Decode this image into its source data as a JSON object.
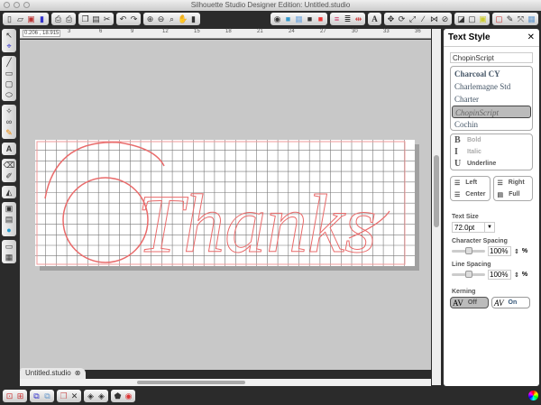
{
  "window": {
    "title": "Silhouette Studio Designer Edition: Untitled.studio"
  },
  "toolbar": {
    "icons": [
      "new",
      "open",
      "save",
      "save-to-sd",
      "print",
      "print-cut",
      "copy",
      "paste",
      "cut",
      "undo",
      "redo",
      "zoom-in",
      "zoom-out",
      "zoom-select",
      "pan",
      "fit-page",
      "fill-color",
      "line-color",
      "gradient",
      "fill-pattern",
      "transparency",
      "line-style",
      "line-weight",
      "line-join",
      "text-style",
      "transform",
      "rotate",
      "scale",
      "move",
      "replicate",
      "modify",
      "offset",
      "page-setup",
      "cut-style",
      "registration",
      "library",
      "knife",
      "expand",
      "grid"
    ],
    "letter_A": "A"
  },
  "ruler": {
    "coord": "0.206 , 18.915",
    "ticks": [
      "3",
      "6",
      "9",
      "12",
      "15",
      "18",
      "21",
      "24",
      "27",
      "30",
      "33",
      "36"
    ]
  },
  "canvas": {
    "text": "Thanks",
    "stroke_color": "#e96b6b"
  },
  "tab": {
    "label": "Untitled.studio"
  },
  "panel": {
    "title": "Text Style",
    "font_value": "ChopinScript",
    "fonts": [
      "Charcoal CY",
      "Charlemagne Std",
      "Charter",
      "ChopinScript",
      "Cochin"
    ],
    "selected_font": "ChopinScript",
    "styles": [
      {
        "icon": "B",
        "label": "Bold"
      },
      {
        "icon": "I",
        "label": "Italic"
      },
      {
        "icon": "U",
        "label": "Underline"
      }
    ],
    "align": {
      "left": "Left",
      "center": "Center",
      "right": "Right",
      "full": "Full"
    },
    "text_size_label": "Text Size",
    "text_size": "72.0pt",
    "char_spacing_label": "Character Spacing",
    "char_spacing": "100%",
    "line_spacing_label": "Line Spacing",
    "line_spacing": "100%",
    "percent": "%",
    "kerning_label": "Kerning",
    "kerning_off": "Off",
    "kerning_on": "On",
    "kerning_icon": "AV"
  }
}
